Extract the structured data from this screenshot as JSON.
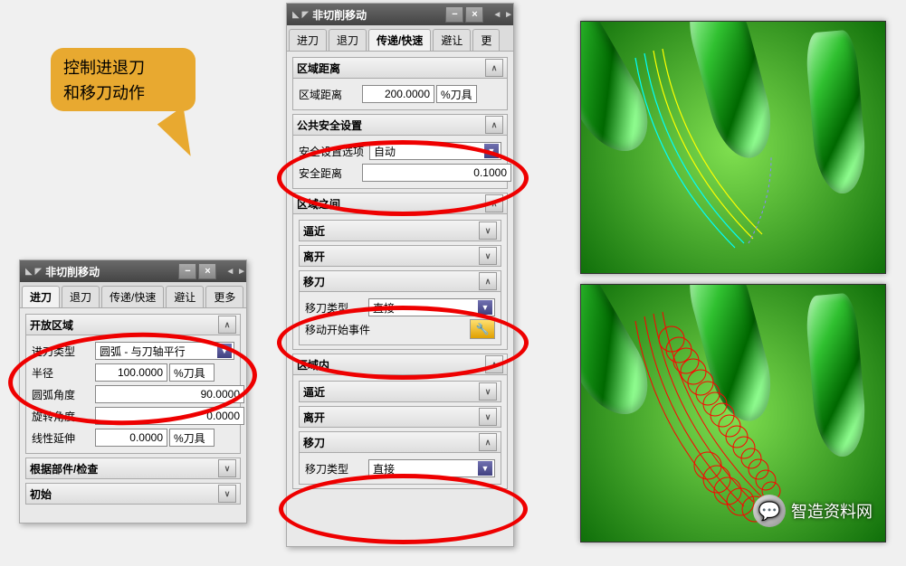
{
  "callout": {
    "line1": "控制进退刀",
    "line2": "和移刀动作"
  },
  "dialog_title": "非切削移动",
  "tabs": [
    "进刀",
    "退刀",
    "传递/快速",
    "避让",
    "更多"
  ],
  "left_panel": {
    "active_tab_index": 0,
    "sections": {
      "open_region": {
        "title": "开放区域",
        "approach_type_label": "进刀类型",
        "approach_type_value": "圆弧 - 与刀轴平行",
        "radius_label": "半径",
        "radius_value": "100.0000",
        "radius_unit": "%刀具",
        "arc_angle_label": "圆弧角度",
        "arc_angle_value": "90.0000",
        "rotate_angle_label": "旋转角度",
        "rotate_angle_value": "0.0000",
        "linear_ext_label": "线性延伸",
        "linear_ext_value": "0.0000",
        "linear_ext_unit": "%刀具"
      },
      "root_check": {
        "title": "根据部件/检查"
      },
      "initial": {
        "title": "初始"
      }
    }
  },
  "center_panel": {
    "active_tab_index": 2,
    "sections": {
      "region_dist": {
        "title": "区域距离",
        "label": "区域距离",
        "value": "200.0000",
        "unit": "%刀具"
      },
      "common_safe": {
        "title": "公共安全设置",
        "safe_option_label": "安全设置选项",
        "safe_option_value": "自动",
        "safe_dist_label": "安全距离",
        "safe_dist_value": "0.1000"
      },
      "between_regions": {
        "title": "区域之间",
        "approach": "逼近",
        "leave": "离开",
        "move": "移刀",
        "move_type_label": "移刀类型",
        "move_type_value": "直接",
        "move_start_event_label": "移动开始事件"
      },
      "in_region": {
        "title": "区域内",
        "approach": "逼近",
        "leave": "离开",
        "move": "移刀",
        "move_type_label": "移刀类型",
        "move_type_value": "直接"
      }
    }
  },
  "watermark": "智造资料网"
}
